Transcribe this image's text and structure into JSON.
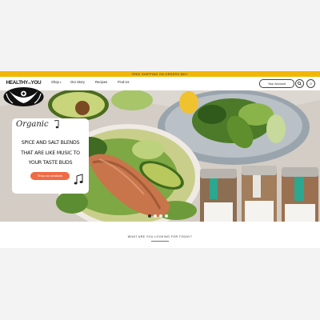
{
  "announcement": "FREE SHIPPING ON ORDERS $50+",
  "brand": {
    "name_part1": "HEALTHY",
    "name_part2": "on",
    "name_part3": "YOU"
  },
  "nav": [
    {
      "label": "Shop",
      "has_dropdown": true
    },
    {
      "label": "Our Story"
    },
    {
      "label": "Recipes"
    },
    {
      "label": "Find Us"
    }
  ],
  "header_actions": {
    "account_label": "Your Account",
    "search_icon": "search-icon",
    "cart_count": "0"
  },
  "hero": {
    "script_text": "Organic",
    "heading_line1": "SPICE AND SALT BLENDS",
    "heading_line2": "THAT ARE LIKE MUSIC TO",
    "heading_line3": "YOUR TASTE BUDS",
    "button_label": "Shop our products",
    "jar_labels": [
      "Bohemian Rhapsody",
      "Let the Good Thyme Roll"
    ],
    "slide_count": 4,
    "active_slide": 1
  },
  "search_section": {
    "prompt": "WHAT ARE YOU LOOKING FOR TODAY?"
  },
  "colors": {
    "announcement_bg": "#f2b705",
    "button_accent": "#ef6b45",
    "page_bg": "#f3f3f3"
  }
}
